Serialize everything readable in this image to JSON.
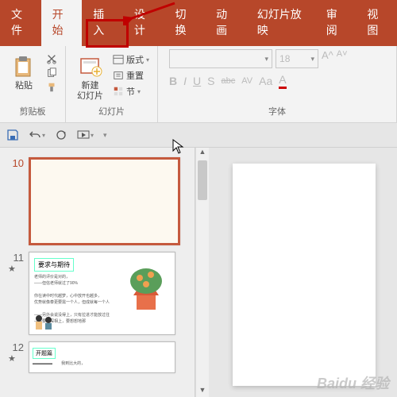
{
  "tabs": {
    "file": "文件",
    "home": "开始",
    "insert": "插入",
    "design": "设计",
    "transitions": "切换",
    "animations": "动画",
    "slideshow": "幻灯片放映",
    "review": "审阅",
    "view": "视图"
  },
  "ribbon": {
    "clipboard": {
      "label": "剪贴板",
      "paste": "粘贴"
    },
    "slides": {
      "label": "幻灯片",
      "new_slide": "新建\n幻灯片",
      "layout": "版式",
      "reset": "重置",
      "section": "节"
    },
    "font": {
      "label": "字体",
      "size_value": "18",
      "bold": "B",
      "italic": "I",
      "underline": "U",
      "shadow": "S",
      "strike": "abc",
      "spacing": "AV",
      "case": "Aa"
    }
  },
  "thumbs": {
    "n10": "10",
    "n11": "11",
    "n12": "12",
    "t11_title": "要求与期待",
    "t12_title": "开题篇"
  },
  "watermark": "Baidu 经验"
}
